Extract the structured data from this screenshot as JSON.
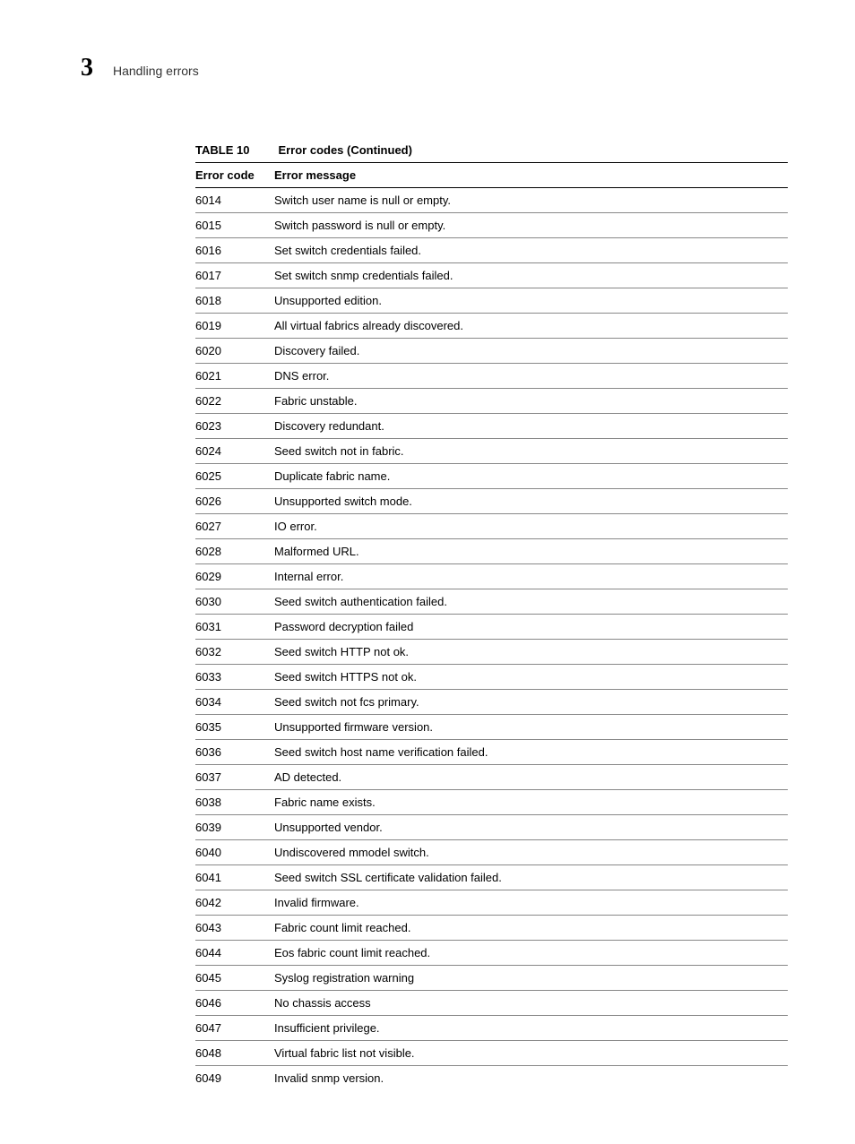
{
  "header": {
    "chapter_number": "3",
    "section_title": "Handling errors"
  },
  "table": {
    "label": "TABLE 10",
    "title": "Error codes (Continued)",
    "columns": {
      "code": "Error code",
      "message": "Error message"
    },
    "rows": [
      {
        "code": "6014",
        "message": "Switch user name is null or empty."
      },
      {
        "code": "6015",
        "message": "Switch password is null or empty."
      },
      {
        "code": "6016",
        "message": "Set switch credentials failed."
      },
      {
        "code": "6017",
        "message": "Set switch snmp credentials failed."
      },
      {
        "code": "6018",
        "message": "Unsupported edition."
      },
      {
        "code": "6019",
        "message": "All virtual fabrics already discovered."
      },
      {
        "code": "6020",
        "message": "Discovery failed."
      },
      {
        "code": "6021",
        "message": "DNS error."
      },
      {
        "code": "6022",
        "message": "Fabric unstable."
      },
      {
        "code": "6023",
        "message": "Discovery redundant."
      },
      {
        "code": "6024",
        "message": "Seed switch not in fabric."
      },
      {
        "code": "6025",
        "message": "Duplicate fabric name."
      },
      {
        "code": "6026",
        "message": "Unsupported switch mode."
      },
      {
        "code": "6027",
        "message": "IO error."
      },
      {
        "code": "6028",
        "message": "Malformed URL."
      },
      {
        "code": "6029",
        "message": "Internal error."
      },
      {
        "code": "6030",
        "message": "Seed switch authentication failed."
      },
      {
        "code": "6031",
        "message": "Password decryption failed"
      },
      {
        "code": "6032",
        "message": "Seed switch HTTP not ok."
      },
      {
        "code": "6033",
        "message": "Seed switch HTTPS not ok."
      },
      {
        "code": "6034",
        "message": "Seed switch not fcs primary."
      },
      {
        "code": "6035",
        "message": "Unsupported firmware version."
      },
      {
        "code": "6036",
        "message": "Seed switch host name verification failed."
      },
      {
        "code": "6037",
        "message": "AD detected."
      },
      {
        "code": "6038",
        "message": "Fabric name exists."
      },
      {
        "code": "6039",
        "message": "Unsupported vendor."
      },
      {
        "code": "6040",
        "message": "Undiscovered mmodel switch."
      },
      {
        "code": "6041",
        "message": "Seed switch SSL certificate validation failed."
      },
      {
        "code": "6042",
        "message": "Invalid firmware."
      },
      {
        "code": "6043",
        "message": "Fabric count limit reached."
      },
      {
        "code": "6044",
        "message": "Eos fabric count limit reached."
      },
      {
        "code": "6045",
        "message": "Syslog registration warning"
      },
      {
        "code": "6046",
        "message": "No chassis access"
      },
      {
        "code": "6047",
        "message": "Insufficient privilege."
      },
      {
        "code": "6048",
        "message": "Virtual fabric list not visible."
      },
      {
        "code": "6049",
        "message": "Invalid snmp version."
      }
    ]
  }
}
